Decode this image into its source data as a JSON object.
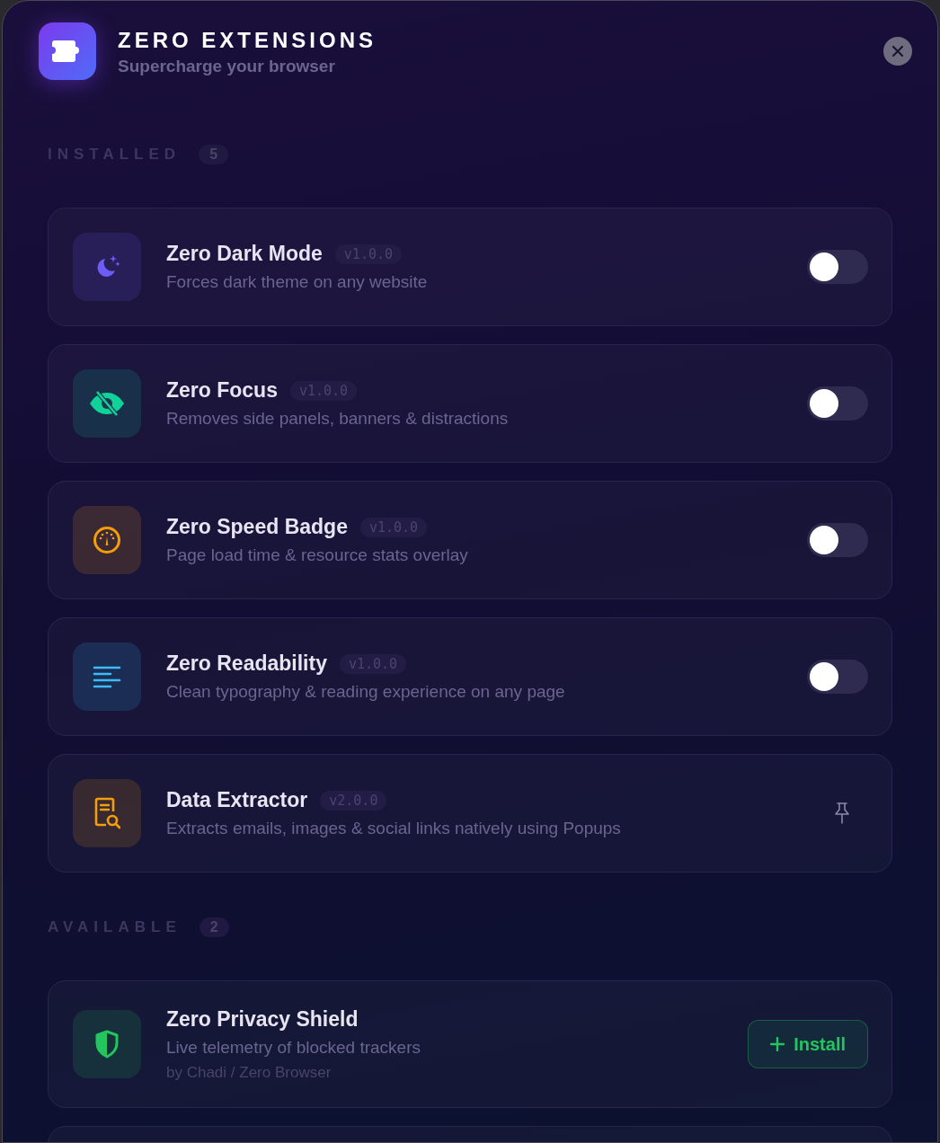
{
  "header": {
    "title": "ZERO EXTENSIONS",
    "subtitle": "Supercharge your browser"
  },
  "installed": {
    "label": "INSTALLED",
    "count": "5",
    "items": [
      {
        "name": "Zero Dark Mode",
        "version": "v1.0.0",
        "description": "Forces dark theme on any website",
        "color": "#6d5cf5",
        "kind": "toggle",
        "on": false
      },
      {
        "name": "Zero Focus",
        "version": "v1.0.0",
        "description": "Removes side panels, banners & distractions",
        "color": "#10d39a",
        "kind": "toggle",
        "on": false
      },
      {
        "name": "Zero Speed Badge",
        "version": "v1.0.0",
        "description": "Page load time & resource stats overlay",
        "color": "#f59e0b",
        "kind": "toggle",
        "on": false
      },
      {
        "name": "Zero Readability",
        "version": "v1.0.0",
        "description": "Clean typography & reading experience on any page",
        "color": "#38bdf8",
        "kind": "toggle",
        "on": false
      },
      {
        "name": "Data Extractor",
        "version": "v2.0.0",
        "description": "Extracts emails, images & social links natively using Popups",
        "color": "#f59e0b",
        "kind": "pinned"
      }
    ]
  },
  "available": {
    "label": "AVAILABLE",
    "count": "2",
    "items": [
      {
        "name": "Zero Privacy Shield",
        "description": "Live telemetry of blocked trackers",
        "author": "by Chadi / Zero Browser",
        "color": "#22c55e",
        "button": "Install"
      }
    ]
  }
}
